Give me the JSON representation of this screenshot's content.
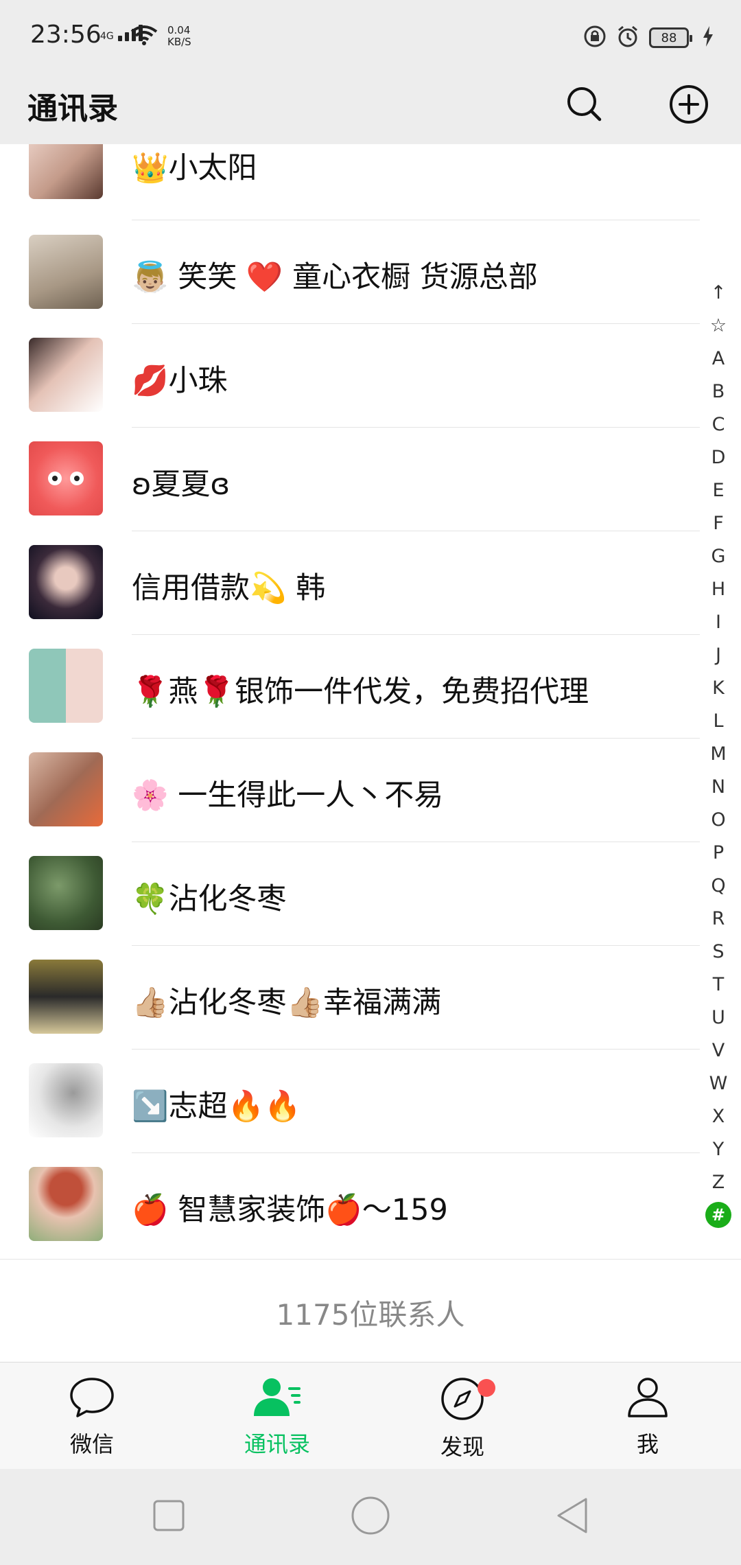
{
  "status_bar": {
    "time": "23:56",
    "network": "4G",
    "speed_value": "0.04",
    "speed_unit": "KB/S",
    "battery": "88"
  },
  "header": {
    "title": "通讯录",
    "search_icon": "search-icon",
    "add_icon": "plus-circle-icon"
  },
  "contacts": [
    {
      "name": "👑小太阳"
    },
    {
      "name": "👼🏼 笑笑 ❤️ 童心衣橱 货源总部"
    },
    {
      "name": "💋小珠"
    },
    {
      "name": "ʚ夏夏ɞ"
    },
    {
      "name": "信用借款💫 韩"
    },
    {
      "name": "🌹燕🌹银饰一件代发，免费招代理"
    },
    {
      "name": "🌸 一生得此一人丶不易"
    },
    {
      "name": "🍀沾化冬枣"
    },
    {
      "name": "👍🏼沾化冬枣👍🏼幸福满满"
    },
    {
      "name": "↘️志超🔥🔥"
    },
    {
      "name": "🍎 智慧家装饰🍎～159"
    }
  ],
  "contact_count": "1175位联系人",
  "alpha_index": [
    "↑",
    "☆",
    "A",
    "B",
    "C",
    "D",
    "E",
    "F",
    "G",
    "H",
    "I",
    "J",
    "K",
    "L",
    "M",
    "N",
    "O",
    "P",
    "Q",
    "R",
    "S",
    "T",
    "U",
    "V",
    "W",
    "X",
    "Y",
    "Z",
    "#"
  ],
  "alpha_active": "#",
  "tabs": [
    {
      "label": "微信",
      "icon": "chat-bubble-icon"
    },
    {
      "label": "通讯录",
      "icon": "contacts-icon"
    },
    {
      "label": "发现",
      "icon": "compass-icon"
    },
    {
      "label": "我",
      "icon": "person-icon"
    }
  ],
  "colors": {
    "accent": "#07c160",
    "index_active": "#1aad19",
    "badge": "#fa5151",
    "background": "#ededed"
  }
}
